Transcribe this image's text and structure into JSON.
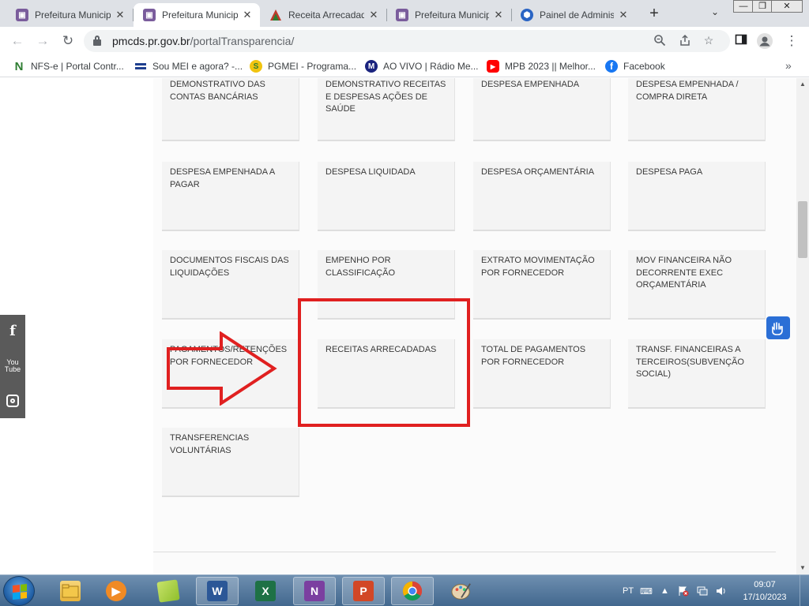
{
  "browser": {
    "tabs": [
      {
        "title": "Prefeitura Municipal",
        "favicon_color": "#7a5c9c",
        "active": false
      },
      {
        "title": "Prefeitura Municipal",
        "favicon_color": "#7a5c9c",
        "active": true
      },
      {
        "title": "Receita Arrecadada",
        "favicon_color": "#c0392b",
        "active": false
      },
      {
        "title": "Prefeitura Municipal",
        "favicon_color": "#7a5c9c",
        "active": false
      },
      {
        "title": "Painel de Administração",
        "favicon_color": "#2a64c4",
        "active": false
      }
    ],
    "close_glyph": "✕",
    "new_tab_glyph": "+",
    "tab_search_glyph": "⌄",
    "window_controls": {
      "minimize": "—",
      "maximize": "❐",
      "close": "✕"
    },
    "url_host": "pmcds.pr.gov.br",
    "url_path": "/portalTransparencia/",
    "bookmarks": [
      {
        "label": "NFS-e | Portal Contr...",
        "icon": "nfse-icon",
        "color": "#2e7d32"
      },
      {
        "label": "Sou MEI e agora? -...",
        "icon": "mei-icon",
        "color": "#1f3f8f"
      },
      {
        "label": "PGMEI - Programa...",
        "icon": "pgmei-icon",
        "color": "#f1c40f"
      },
      {
        "label": "AO VIVO | Rádio Me...",
        "icon": "radio-icon",
        "color": "#1a237e"
      },
      {
        "label": "MPB 2023 || Melhor...",
        "icon": "youtube-icon",
        "color": "#ff0000"
      },
      {
        "label": "Facebook",
        "icon": "facebook-icon",
        "color": "#1877f2"
      }
    ],
    "bookmarks_more": "»"
  },
  "portal": {
    "cards": [
      "DEMONSTRATIVO DAS CONTAS BANCÁRIAS",
      "DEMONSTRATIVO RECEITAS E DESPESAS AÇÕES DE SAÚDE",
      "DESPESA EMPENHADA",
      "DESPESA EMPENHADA / COMPRA DIRETA",
      "DESPESA EMPENHADA A PAGAR",
      "DESPESA LIQUIDADA",
      "DESPESA ORÇAMENTÁRIA",
      "DESPESA PAGA",
      "DOCUMENTOS FISCAIS DAS LIQUIDAÇÕES",
      "EMPENHO POR CLASSIFICAÇÃO",
      "EXTRATO MOVIMENTAÇÃO POR FORNECEDOR",
      "MOV FINANCEIRA NÃO DECORRENTE EXEC ORÇAMENTÁRIA",
      "PAGAMENTOS/RETENÇÕES POR FORNECEDOR",
      "RECEITAS ARRECADADAS",
      "TOTAL DE PAGAMENTOS POR FORNECEDOR",
      "TRANSF. FINANCEIRAS A TERCEIROS(SUBVENÇÃO SOCIAL)",
      "TRANSFERENCIAS VOLUNTÁRIAS"
    ],
    "highlighted_card": "RECEITAS ARRECADADAS",
    "highlight_color": "#e02020",
    "social": {
      "facebook": "f",
      "youtube_top": "You",
      "youtube_bottom": "Tube"
    }
  },
  "taskbar": {
    "language": "PT",
    "time": "09:07",
    "date": "17/10/2023",
    "apps": [
      {
        "icon": "explorer-icon",
        "color": "#e8b43a",
        "letter": ""
      },
      {
        "icon": "media-player-icon",
        "color": "#f08a24",
        "letter": "▶"
      },
      {
        "icon": "sticky-notes-icon",
        "color": "#9bc13c",
        "letter": ""
      },
      {
        "icon": "word-icon",
        "color": "#2b5797",
        "letter": "W"
      },
      {
        "icon": "excel-icon",
        "color": "#1e7145",
        "letter": "X"
      },
      {
        "icon": "onenote-icon",
        "color": "#7b3fa0",
        "letter": "N"
      },
      {
        "icon": "powerpoint-icon",
        "color": "#d24726",
        "letter": "P"
      },
      {
        "icon": "chrome-icon",
        "color": "#4285f4",
        "letter": ""
      },
      {
        "icon": "paint-icon",
        "color": "#4a90c8",
        "letter": ""
      }
    ]
  }
}
